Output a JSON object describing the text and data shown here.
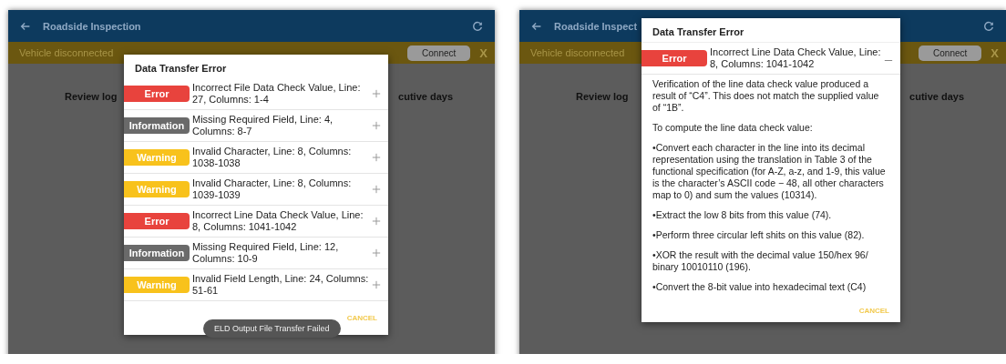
{
  "screens": [
    {
      "app_bar": {
        "title": "Roadside Inspection"
      },
      "banner": {
        "text": "Vehicle disconnected",
        "button": "Connect",
        "close": "X"
      },
      "background_texts": [
        "Review log",
        "cutive days"
      ],
      "dialog": {
        "title": "Data Transfer Error",
        "items": [
          {
            "kind": "error",
            "badge": "Error",
            "text": "Incorrect File Data Check Value, Line: 27, Columns: 1-4",
            "expanded": false
          },
          {
            "kind": "information",
            "badge": "Information",
            "text": "Missing Required Field, Line: 4, Columns: 8-7",
            "expanded": false
          },
          {
            "kind": "warning",
            "badge": "Warning",
            "text": "Invalid Character, Line: 8, Columns: 1038-1038",
            "expanded": false
          },
          {
            "kind": "warning",
            "badge": "Warning",
            "text": "Invalid Character, Line: 8, Columns: 1039-1039",
            "expanded": false
          },
          {
            "kind": "error",
            "badge": "Error",
            "text": "Incorrect Line Data Check Value, Line: 8, Columns: 1041-1042",
            "expanded": false
          },
          {
            "kind": "information",
            "badge": "Information",
            "text": "Missing Required Field, Line: 12, Columns: 10-9",
            "expanded": false
          },
          {
            "kind": "warning",
            "badge": "Warning",
            "text": "Invalid Field Length, Line: 24, Columns: 51-61",
            "expanded": false
          }
        ],
        "cancel": "CANCEL"
      },
      "toast": "ELD Output File Transfer Failed"
    },
    {
      "app_bar": {
        "title": "Roadside Inspect"
      },
      "banner": {
        "text": "Vehicle disconnected",
        "button": "Connect",
        "close": "X"
      },
      "background_texts": [
        "Review log",
        "cutive days"
      ],
      "dialog": {
        "title": "Data Transfer Error",
        "items": [
          {
            "kind": "error",
            "badge": "Error",
            "text": "Incorrect Line Data Check Value, Line: 8, Columns: 1041-1042",
            "expanded": true,
            "details": [
              "Verification of the line data check value produced a result of “C4”. This does not match the supplied value of “1B”.",
              "To compute the line data check value:",
              "•Convert each character in the line into its decimal representation using the translation in Table 3 of the functional specification (for A-Z, a-z, and 1-9, this value is the character’s ASCII code − 48, all other characters map to 0) and sum the values (10314).",
              "•Extract the low 8 bits from this value (74).",
              "•Perform three circular left shits on this value (82).",
              "•XOR the result with the decimal value 150/hex 96/ binary 10010110 (196).",
              "•Convert the 8-bit value into hexadecimal text (C4)"
            ]
          }
        ],
        "cancel": "CANCEL"
      }
    }
  ]
}
